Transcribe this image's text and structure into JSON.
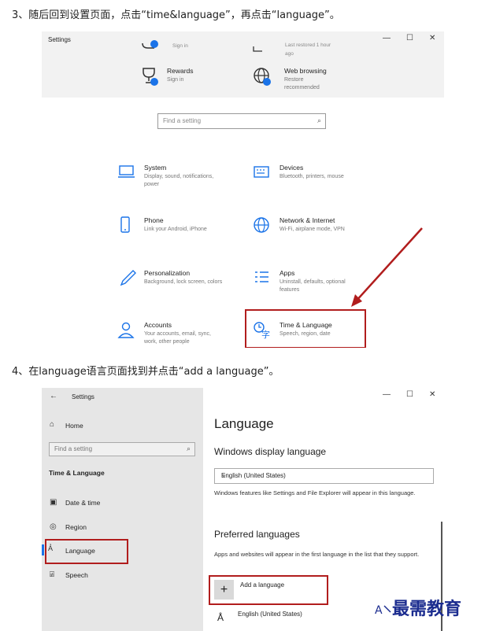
{
  "steps": {
    "step3": "3、随后回到设置页面，点击“time&language”，再点击“language”。",
    "step4": "4、在language语言页面找到并点击“add a language”。"
  },
  "shot1": {
    "window_title": "Settings",
    "controls": {
      "min": "—",
      "max": "☐",
      "close": "✕"
    },
    "partial_left": "Sign in",
    "partial_right": "Last restored 1 hour",
    "partial_right2": "ago",
    "top_tiles": [
      {
        "name": "Rewards",
        "desc": "Sign in"
      },
      {
        "name": "Web browsing",
        "desc": "Restore recommended"
      }
    ],
    "search_placeholder": "Find a setting",
    "tiles": [
      {
        "name": "System",
        "desc": "Display, sound, notifications, power"
      },
      {
        "name": "Devices",
        "desc": "Bluetooth, printers, mouse"
      },
      {
        "name": "Phone",
        "desc": "Link your Android, iPhone"
      },
      {
        "name": "Network & Internet",
        "desc": "Wi-Fi, airplane mode, VPN"
      },
      {
        "name": "Personalization",
        "desc": "Background, lock screen, colors"
      },
      {
        "name": "Apps",
        "desc": "Uninstall, defaults, optional features"
      },
      {
        "name": "Accounts",
        "desc": "Your accounts, email, sync, work, other people"
      },
      {
        "name": "Time & Language",
        "desc": "Speech, region, date"
      }
    ],
    "colors": {
      "highlight": "#b11d1d",
      "accent": "#1a73e8"
    }
  },
  "shot2": {
    "window_title": "Settings",
    "controls": {
      "min": "—",
      "max": "☐",
      "close": "✕"
    },
    "sidebar": {
      "home": "Home",
      "search_placeholder": "Find a setting",
      "section": "Time & Language",
      "items": [
        {
          "label": "Date & time",
          "icon": "calendar-icon"
        },
        {
          "label": "Region",
          "icon": "globe-icon"
        },
        {
          "label": "Language",
          "icon": "language-icon"
        },
        {
          "label": "Speech",
          "icon": "microphone-icon"
        }
      ]
    },
    "main": {
      "title": "Language",
      "display_heading": "Windows display language",
      "display_value": "English (United States)",
      "display_note": "Windows features like Settings and File Explorer will appear in this language.",
      "preferred_heading": "Preferred languages",
      "preferred_note": "Apps and websites will appear in the first language in the list that they support.",
      "add_label": "Add a language",
      "lang_item": "English (United States)"
    }
  },
  "watermark": "最需教育"
}
